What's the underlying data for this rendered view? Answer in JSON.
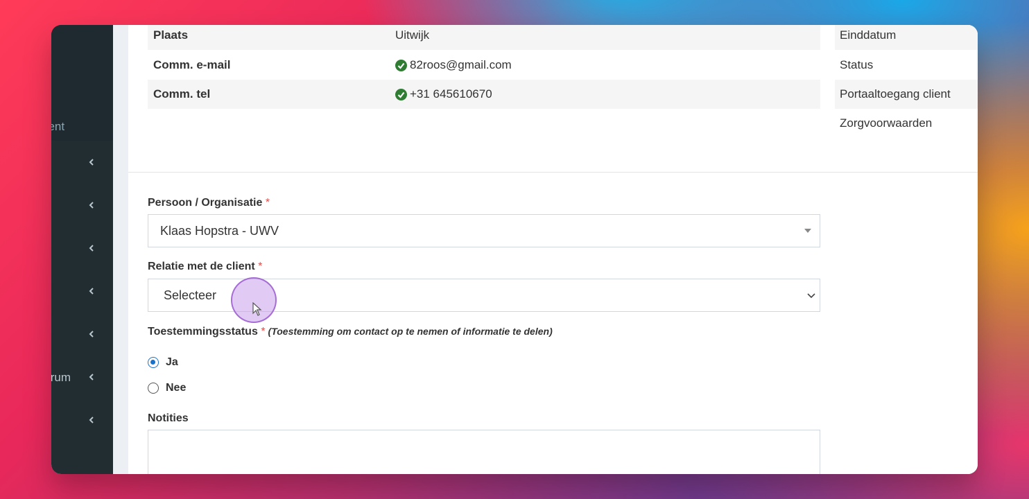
{
  "sidebar": {
    "labels": [
      "nent",
      "trum"
    ]
  },
  "details": {
    "rows": [
      {
        "key": "Plaats",
        "value": "Uitwijk",
        "verified": false
      },
      {
        "key": "Comm. e-mail",
        "value": "82roos@gmail.com",
        "verified": true
      },
      {
        "key": "Comm. tel",
        "value": "+31 645610670",
        "verified": true
      }
    ],
    "right_column": [
      "Einddatum",
      "Status",
      "Portaaltoegang client",
      "Zorgvoorwaarden"
    ]
  },
  "form": {
    "persoon_label": "Persoon / Organisatie",
    "persoon_value": "Klaas Hopstra - UWV",
    "relatie_label": "Relatie met de client",
    "relatie_value": "Selecteer",
    "toestemming_label": "Toestemmingsstatus",
    "toestemming_hint": "(Toestemming om contact op te nemen of informatie te delen)",
    "required_mark": "*",
    "options": [
      {
        "label": "Ja",
        "selected": true
      },
      {
        "label": "Nee",
        "selected": false
      }
    ],
    "notities_label": "Notities"
  },
  "colors": {
    "sidebar_bg": "#222d32",
    "accent_radio": "#1a73c8",
    "required": "#d9534f",
    "verified": "#2e7d32"
  }
}
